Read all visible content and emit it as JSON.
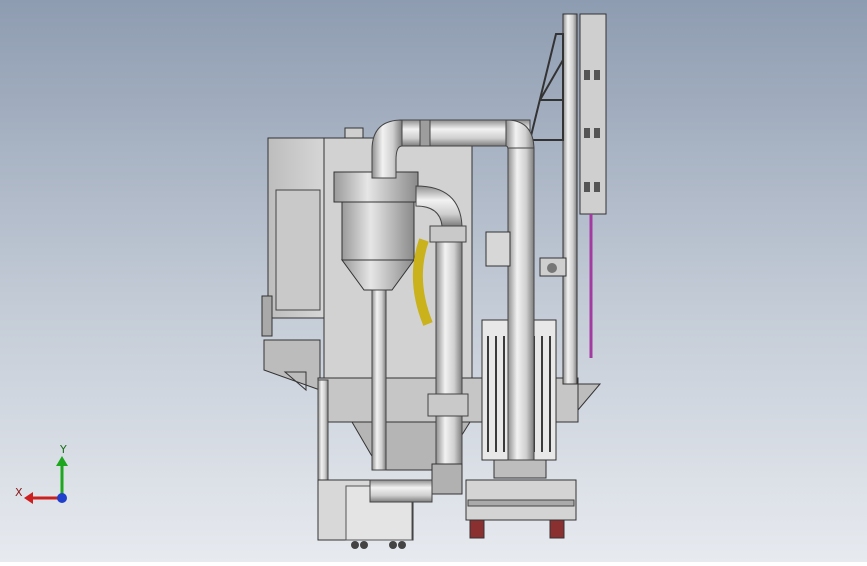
{
  "view": {
    "background_top": "#8e9cb1",
    "background_bottom": "#e7eaef"
  },
  "triad": {
    "x_label": "X",
    "y_label": "Y",
    "x_color": "#cc1f1f",
    "y_color": "#1fa61f",
    "z_color": "#1f3fcc"
  },
  "icons": [
    "coordinate-triad-icon"
  ]
}
